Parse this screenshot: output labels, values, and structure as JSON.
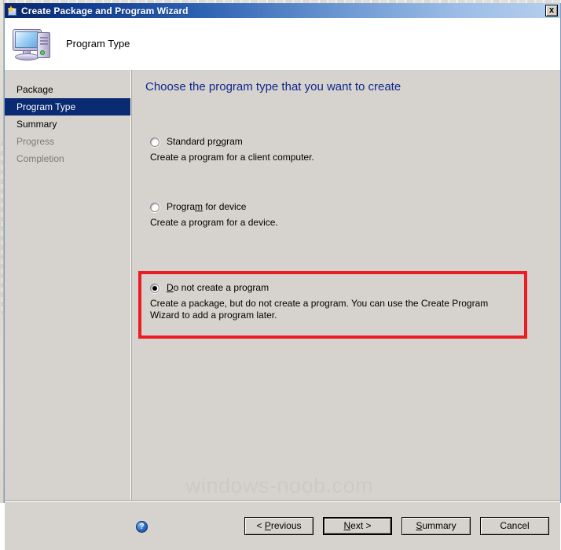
{
  "window": {
    "title": "Create Package and Program Wizard",
    "close_label": "x",
    "title_icon": "package-wizard-icon"
  },
  "header": {
    "title": "Program Type",
    "icon": "computer-icon"
  },
  "sidebar": {
    "items": [
      {
        "label": "Package",
        "state": "done"
      },
      {
        "label": "Program Type",
        "state": "current"
      },
      {
        "label": "Summary",
        "state": "done"
      },
      {
        "label": "Progress",
        "state": "disabled"
      },
      {
        "label": "Completion",
        "state": "disabled"
      }
    ]
  },
  "content": {
    "heading": "Choose the program type that you want to create",
    "options": [
      {
        "id": "standard-program",
        "label_before": "Standard pr",
        "label_accel": "o",
        "label_after": "gram",
        "label_full": "Standard program",
        "description": "Create a program for a client computer.",
        "selected": false
      },
      {
        "id": "program-for-device",
        "label_before": "Progra",
        "label_accel": "m",
        "label_after": " for device",
        "label_full": "Program for device",
        "description": "Create a program for a device.",
        "selected": false
      },
      {
        "id": "do-not-create-program",
        "label_before": "",
        "label_accel": "D",
        "label_after": "o not create a program",
        "label_full": "Do not create a program",
        "description": "Create a package, but do not create a program. You can use the Create Program Wizard to add a program later.",
        "selected": true,
        "highlighted": true
      }
    ]
  },
  "footer": {
    "help_label": "?",
    "buttons": [
      {
        "id": "previous",
        "before": "< ",
        "accel": "P",
        "after": "revious",
        "full": "< Previous",
        "focused": false
      },
      {
        "id": "next",
        "before": "",
        "accel": "N",
        "after": "ext >",
        "full": "Next >",
        "focused": true
      },
      {
        "id": "summary",
        "before": "",
        "accel": "S",
        "after": "ummary",
        "full": "Summary",
        "focused": false
      },
      {
        "id": "cancel",
        "before": "Cancel",
        "accel": "",
        "after": "",
        "full": "Cancel",
        "focused": false
      }
    ]
  },
  "watermark": {
    "text": "windows-noob.com"
  },
  "colors": {
    "title_gradient_start": "#0a246a",
    "title_gradient_end": "#b5d0ee",
    "heading_blue": "#10258c",
    "nav_selected_bg": "#0a2a72",
    "highlight_red": "#ec1c24",
    "window_face": "#d6d3ce"
  }
}
